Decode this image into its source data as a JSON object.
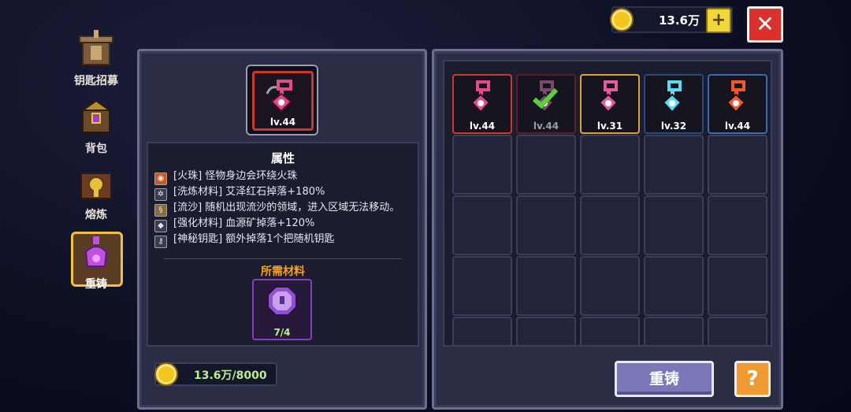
{
  "currency": {
    "amount": "13.6万",
    "add_label": "+"
  },
  "close_label": "✕",
  "sidebar": {
    "items": [
      {
        "label": "钥匙招募"
      },
      {
        "label": "背包"
      },
      {
        "label": "熔炼"
      },
      {
        "label": "重铸",
        "active": true
      }
    ]
  },
  "selected": {
    "level": "lv.44"
  },
  "attributes": {
    "title": "属性",
    "rows": [
      {
        "icon": "fire-orb-icon",
        "text": "[火珠] 怪物身边会环绕火珠"
      },
      {
        "icon": "gear-icon",
        "text": "[洗炼材料] 艾泽红石掉落+180%"
      },
      {
        "icon": "quicksand-icon",
        "text": "[流沙] 随机出现流沙的领域，进入区域无法移动。"
      },
      {
        "icon": "diamond-icon",
        "text": "[强化材料] 血源矿掉落+120%"
      },
      {
        "icon": "key-icon",
        "text": "[神秘钥匙] 额外掉落1个把随机钥匙"
      }
    ]
  },
  "required": {
    "title": "所需材料",
    "count": "7/4"
  },
  "cost": "13.6万/8000",
  "inventory": {
    "items": [
      {
        "level": "lv.44",
        "border": "#c93a2e",
        "color": "#e24a8a"
      },
      {
        "level": "lv.44",
        "border": "#5a1f2a",
        "color": "#7a4a6a",
        "checked": true
      },
      {
        "level": "lv.31",
        "border": "#d9a23a",
        "color": "#e85aa0"
      },
      {
        "level": "lv.32",
        "border": "#2a4a7a",
        "color": "#5adcf0"
      },
      {
        "level": "lv.44",
        "border": "#3a6ab0",
        "color": "#f05a2a"
      }
    ]
  },
  "buttons": {
    "recast": "重铸",
    "help": "?"
  }
}
